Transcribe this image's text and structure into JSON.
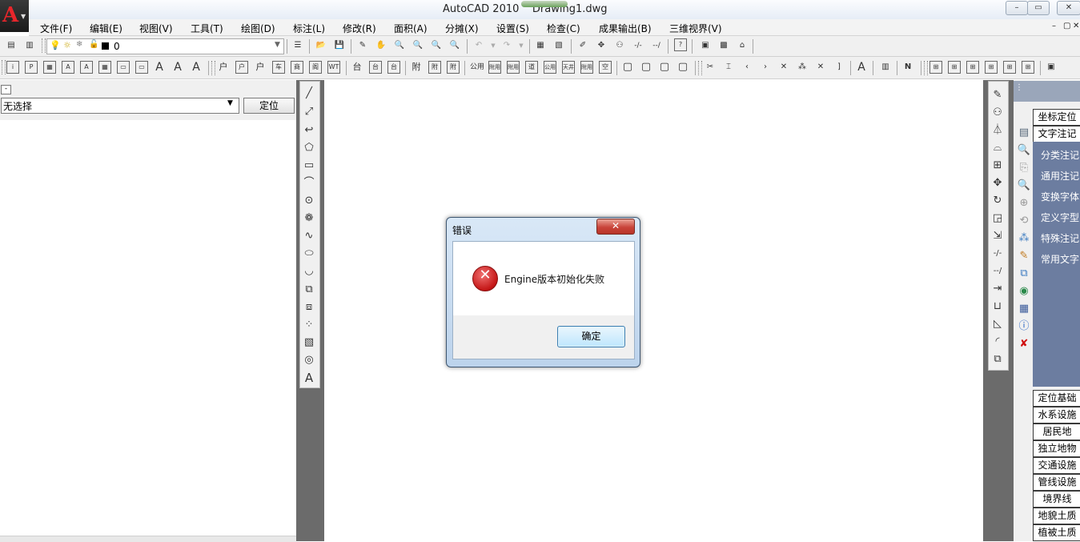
{
  "window": {
    "title": "AutoCAD 2010    Drawing1.dwg",
    "logo_letter": "A",
    "buttons": [
      "–",
      "▭",
      "✕"
    ]
  },
  "menu": {
    "items": [
      "文件(F)",
      "编辑(E)",
      "视图(V)",
      "工具(T)",
      "绘图(D)",
      "标注(L)",
      "修改(R)",
      "面积(A)",
      "分摊(X)",
      "设置(S)",
      "检查(C)",
      "成果输出(B)",
      "三维视界(V)"
    ],
    "mdi_buttons": [
      "–",
      "▢",
      "✕"
    ]
  },
  "layer_toolbar": {
    "layer_value": "0"
  },
  "toolbar2": {
    "buttons": [
      "户",
      "户",
      "户",
      "车",
      "商",
      "阁",
      "WT",
      "台",
      "台",
      "台",
      "附",
      "附",
      "附",
      "公用",
      "附用",
      "附用",
      "道",
      "公用",
      "天井",
      "附用",
      "空"
    ]
  },
  "left_panel": {
    "collapse": "-",
    "select_value": "无选择",
    "locate_button": "定位"
  },
  "right_panel": {
    "buttons_top": [
      "坐标定位",
      "文字注记"
    ],
    "sub_items": [
      "分类注记",
      "通用注记",
      "变换字体",
      "定义字型",
      "特殊注记",
      "常用文字"
    ],
    "buttons_bottom": [
      "定位基础",
      "水系设施",
      "居民地",
      "独立地物",
      "交通设施",
      "管线设施",
      "境界线",
      "地貌土质",
      "植被土质"
    ]
  },
  "dialog": {
    "title": "错误",
    "close": "✕",
    "message": "Engine版本初始化失败",
    "ok_button": "确定"
  },
  "colors": {
    "error_red": "#c41616",
    "panel_blue": "#6c7da0",
    "dark_gap": "#6b6b6b"
  }
}
